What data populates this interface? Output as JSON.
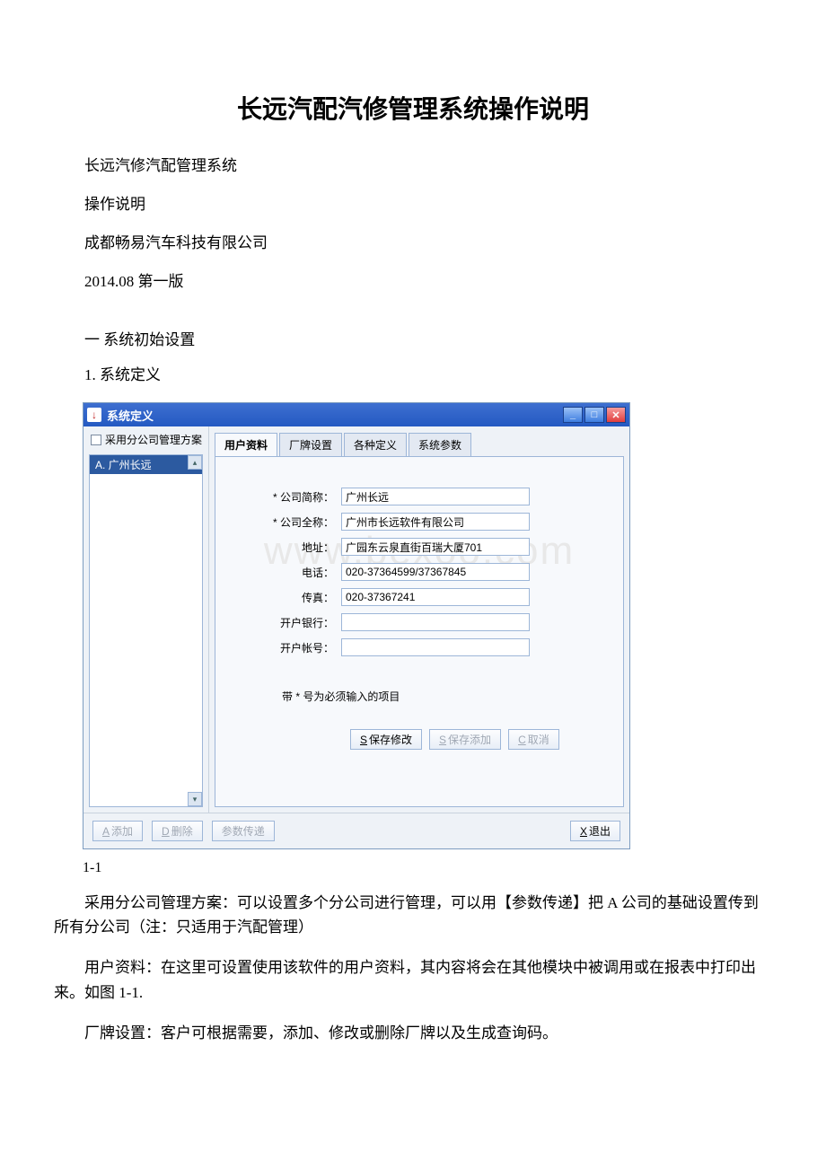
{
  "doc": {
    "title": "长远汽配汽修管理系统操作说明",
    "meta": [
      "长远汽修汽配管理系统",
      "操作说明",
      "成都畅易汽车科技有限公司",
      "2014.08 第一版"
    ],
    "section1": "一 系统初始设置",
    "sub1": "1. 系统定义",
    "figLabel": "1-1",
    "paragraphs": [
      "采用分公司管理方案：可以设置多个分公司进行管理，可以用【参数传递】把 A 公司的基础设置传到所有分公司（注：只适用于汽配管理）",
      "用户资料：在这里可设置使用该软件的用户资料，其内容将会在其他模块中被调用或在报表中打印出来。如图 1-1.",
      "厂牌设置：客户可根据需要，添加、修改或删除厂牌以及生成查询码。"
    ]
  },
  "window": {
    "title": "系统定义",
    "checkboxLabel": "采用分公司管理方案",
    "listItem": "A. 广州长远",
    "tabs": [
      "用户资料",
      "厂牌设置",
      "各种定义",
      "系统参数"
    ],
    "form": {
      "shortNameLabel": "* 公司简称：",
      "shortName": "广州长远",
      "fullNameLabel": "* 公司全称：",
      "fullName": "广州市长远软件有限公司",
      "addressLabel": "地址：",
      "address": "广园东云泉直街百瑞大厦701",
      "phoneLabel": "电话：",
      "phone": "020-37364599/37367845",
      "faxLabel": "传真：",
      "fax": "020-37367241",
      "bankLabel": "开户银行：",
      "bank": "",
      "accountLabel": "开户帐号：",
      "account": ""
    },
    "hint": "带 * 号为必须输入的项目",
    "buttons": {
      "saveModify": "保存修改",
      "saveAdd": "保存添加",
      "cancel": "取消",
      "add": "添加",
      "delete": "删除",
      "transfer": "参数传递",
      "exit": "退出",
      "accel": {
        "saveModify": "S",
        "saveAdd": "S",
        "cancel": "C",
        "add": "A",
        "delete": "D",
        "exit": "X"
      }
    },
    "watermark": "www.bexoo.com"
  }
}
